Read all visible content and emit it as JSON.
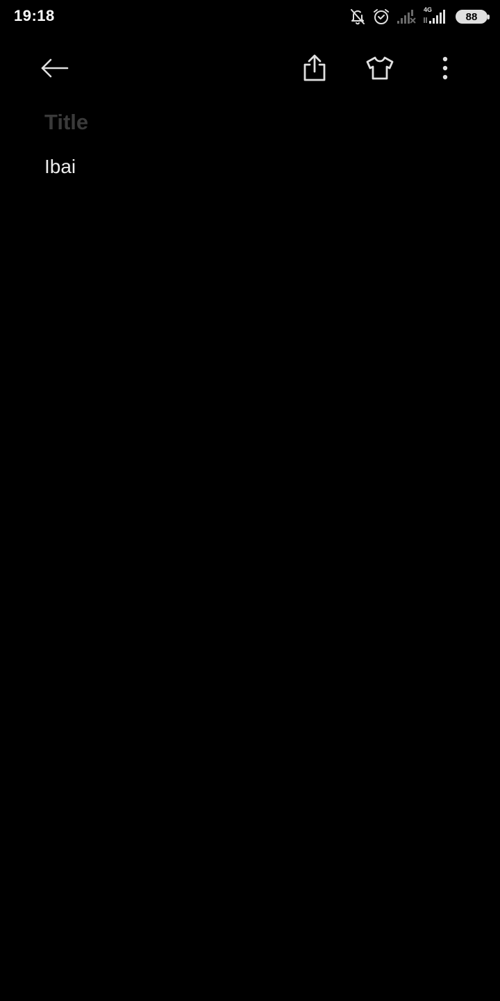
{
  "status_bar": {
    "time": "19:18",
    "battery_level": "88",
    "network_label": "4G",
    "icons": [
      "bell-off-icon",
      "alarm-icon",
      "signal-weak-icon",
      "signal-4g-icon",
      "battery-icon"
    ]
  },
  "toolbar": {
    "icons": [
      "back-arrow-icon",
      "share-icon",
      "tshirt-icon",
      "more-vert-icon"
    ]
  },
  "note": {
    "title_placeholder": "Title",
    "title_value": "",
    "body_text": "Ibai"
  },
  "colors": {
    "background": "#000000",
    "text": "#ededed",
    "placeholder": "#3a3a3a",
    "icon": "#e0e0e0"
  }
}
